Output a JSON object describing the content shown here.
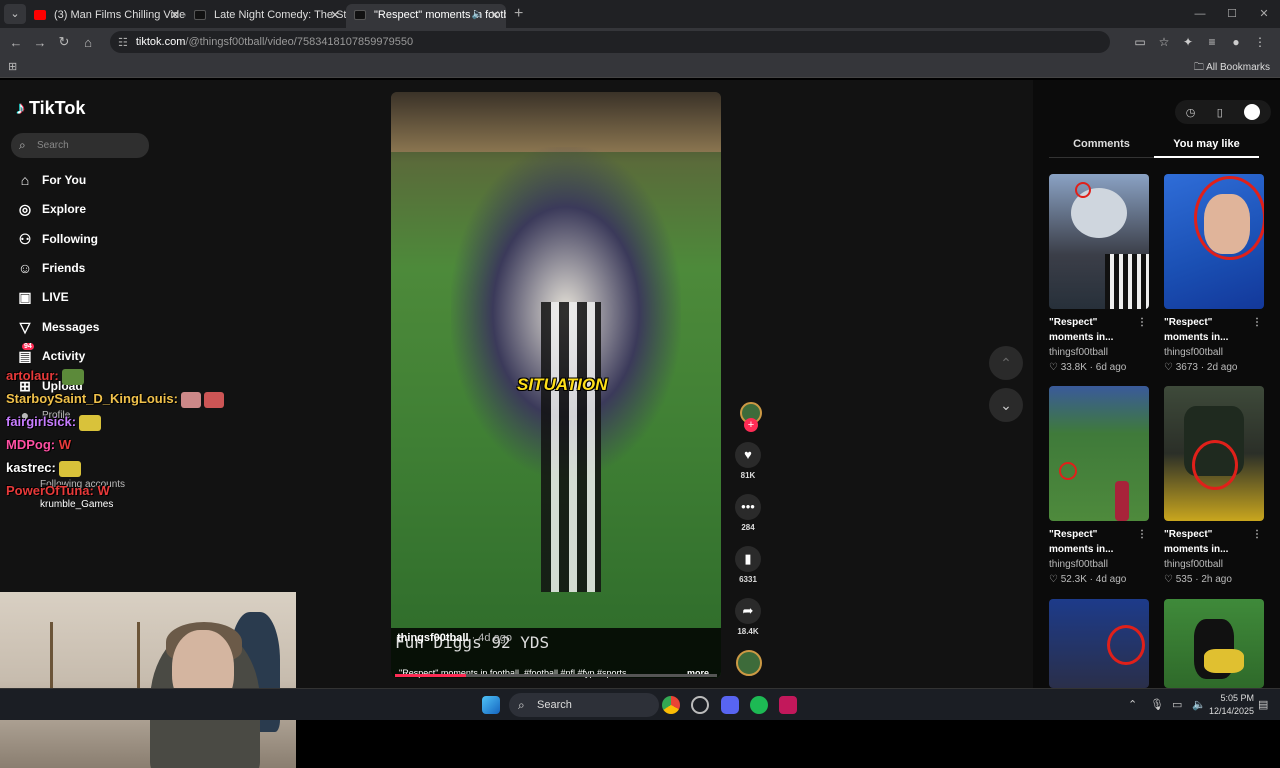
{
  "browser": {
    "tabs": [
      {
        "title": "(3) Man Films Chilling Videos 8",
        "color": "#ff0000",
        "active": false
      },
      {
        "title": "Late Night Comedy: The Strugg",
        "color": "#111111",
        "active": false
      },
      {
        "title": "\"Respect\" moments in footb",
        "color": "#111111",
        "active": true
      }
    ],
    "url_host": "tiktok.com",
    "url_path": "/@thingsf00tball/video/7583418107859979550",
    "bookmarks_label": "All Bookmarks"
  },
  "sidebar": {
    "logo_text": "TikTok",
    "search_placeholder": "Search",
    "nav": [
      {
        "label": "For You",
        "icon": "home-icon"
      },
      {
        "label": "Explore",
        "icon": "compass-icon"
      },
      {
        "label": "Following",
        "icon": "following-icon"
      },
      {
        "label": "Friends",
        "icon": "friends-icon"
      },
      {
        "label": "LIVE",
        "icon": "live-icon"
      },
      {
        "label": "Messages",
        "icon": "messages-icon"
      },
      {
        "label": "Activity",
        "icon": "activity-icon",
        "badge": "94"
      },
      {
        "label": "Upload",
        "icon": "upload-icon"
      },
      {
        "label": "Profile",
        "icon": "profile-icon"
      }
    ],
    "following_accounts_label": "Following accounts",
    "following_accounts": [
      "krumble_Games"
    ]
  },
  "chat": [
    {
      "user": "artolaur:",
      "color": "#e83a3a"
    },
    {
      "user": "StarboySaint_D_KingLouis:",
      "color": "#f0c14b"
    },
    {
      "user": "fairgirlsick:",
      "color": "#c77dff"
    },
    {
      "user": "MDPog:",
      "color": "#ff4fa3",
      "message": "W"
    },
    {
      "user": "kastrec:",
      "color": "#ffffff"
    },
    {
      "user": "PowerOfTuna:",
      "color": "#e83a3a",
      "message": "W"
    }
  ],
  "video": {
    "overlay_text": "SITUATION",
    "score_text": "Fun Diggs  92 YDS",
    "author": "thingsf00tball",
    "author_suffix": "· 4d ago",
    "caption": "\"Respect\" moments in football. #football #nfl #fyp #sports ...",
    "more_label": "more",
    "progress": 0.22
  },
  "actions": {
    "likes": "81K",
    "comments": "284",
    "saves": "6331",
    "shares": "18.4K"
  },
  "right_panel": {
    "tabs": [
      "Comments",
      "You may like"
    ],
    "active_tab": "You may like",
    "cards": [
      {
        "title_line1": "\"Respect\"",
        "title_line2": "moments in...",
        "user": "thingsf00tball",
        "likes": "33.8K",
        "age": "6d ago"
      },
      {
        "title_line1": "\"Respect\"",
        "title_line2": "moments in...",
        "user": "thingsf00tball",
        "likes": "3673",
        "age": "2d ago"
      },
      {
        "title_line1": "\"Respect\"",
        "title_line2": "moments in...",
        "user": "thingsf00tball",
        "likes": "52.3K",
        "age": "4d ago"
      },
      {
        "title_line1": "\"Respect\"",
        "title_line2": "moments in...",
        "user": "thingsf00tball",
        "likes": "535",
        "age": "2h ago"
      }
    ]
  },
  "taskbar": {
    "search_label": "Search",
    "time": "5:05 PM",
    "date": "12/14/2025"
  }
}
